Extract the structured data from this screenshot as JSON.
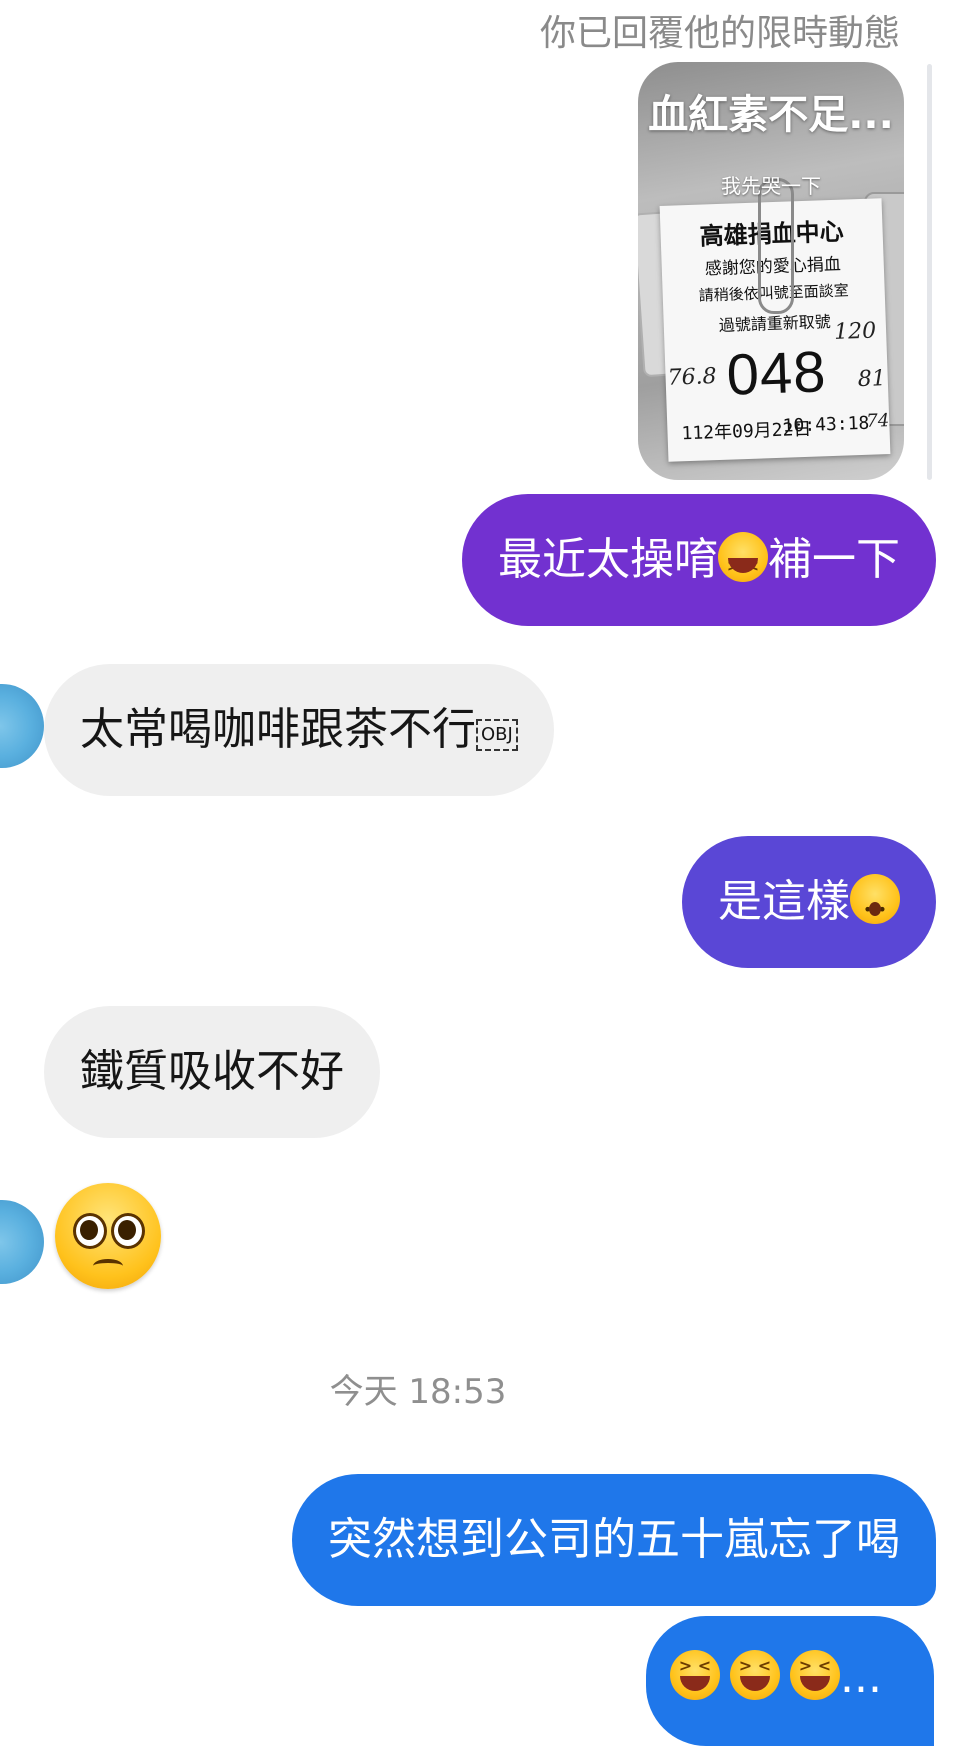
{
  "reply_note": "你已回覆他的限時動態",
  "story": {
    "title": "血紅素不足...",
    "caption": "我先哭一下",
    "ticket": {
      "line1": "高雄捐血中心",
      "line2": "感謝您的愛心捐血",
      "line3": "請稍後依叫號至面談室",
      "line4": "過號請重新取號",
      "number": "048",
      "date": "112年09月22日",
      "time": "10:43:18",
      "hand_left": "76.8",
      "hand_right_top": "120",
      "hand_right_mid": "81",
      "hand_right_bottom": "74"
    }
  },
  "messages": [
    {
      "sender": "me",
      "text": "最近太操唷",
      "emoji": "laughing",
      "text_after": "補一下"
    },
    {
      "sender": "them",
      "text": "太常喝咖啡跟茶不行",
      "obj_marker": "OBJ"
    },
    {
      "sender": "me",
      "text": "是這樣",
      "emoji": "astonished"
    },
    {
      "sender": "them",
      "text": "鐵質吸收不好"
    },
    {
      "sender": "them",
      "emoji": "pleading"
    }
  ],
  "timestamp": "今天 18:53",
  "later_messages": [
    {
      "sender": "me",
      "text": "突然想到公司的五十嵐忘了喝"
    },
    {
      "sender": "me",
      "text": "...",
      "emoji": "laughing x3"
    }
  ],
  "colors": {
    "bubble_purple": "#7231d0",
    "bubble_indigo": "#5a47d6",
    "bubble_blue": "#1f77ea",
    "bubble_gray": "#efefef"
  }
}
